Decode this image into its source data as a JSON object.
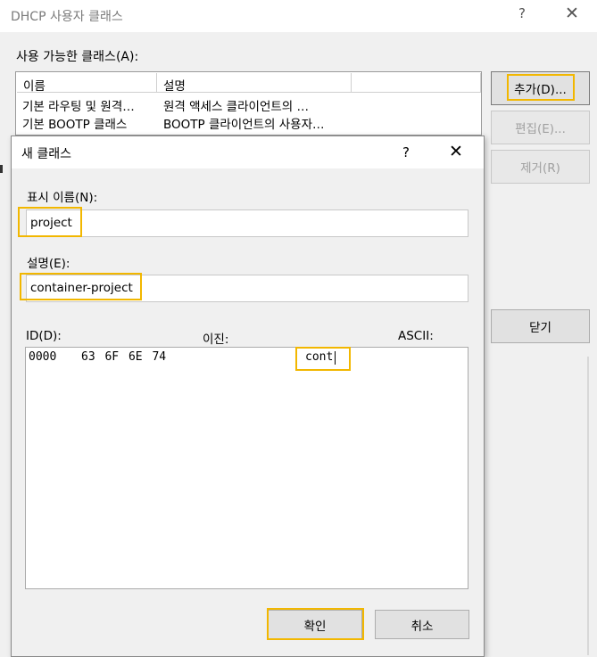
{
  "outer": {
    "title": "DHCP 사용자 클래스",
    "help": "?",
    "close": "✕",
    "available_label": "사용 가능한 클래스(A):",
    "columns": [
      "이름",
      "설명",
      ""
    ],
    "rows": [
      {
        "name": "기본 라우팅 및 원격…",
        "desc": "원격 액세스 클라이언트의 …"
      },
      {
        "name": "기본 BOOTP 클래스",
        "desc": "BOOTP 클라이언트의 사용자…"
      }
    ],
    "add_button": "추가(D)...",
    "edit_button": "편집(E)...",
    "remove_button": "제거(R)",
    "close_button": "닫기"
  },
  "inner": {
    "title": "새 클래스",
    "help": "?",
    "close": "✕",
    "name_label": "표시 이름(N):",
    "name_value": "project",
    "desc_label": "설명(E):",
    "desc_value": "container-project",
    "id_label": "ID(D):",
    "binary_label": "이진:",
    "ascii_label": "ASCII:",
    "data_offset": "0000",
    "data_hex": "63 6F 6E 74",
    "data_ascii": "cont",
    "ok_button": "확인",
    "cancel_button": "취소"
  },
  "colors": {
    "highlight": "#f2b700",
    "button_bg": "#e1e1e1",
    "window_bg": "#f0f0f0"
  }
}
